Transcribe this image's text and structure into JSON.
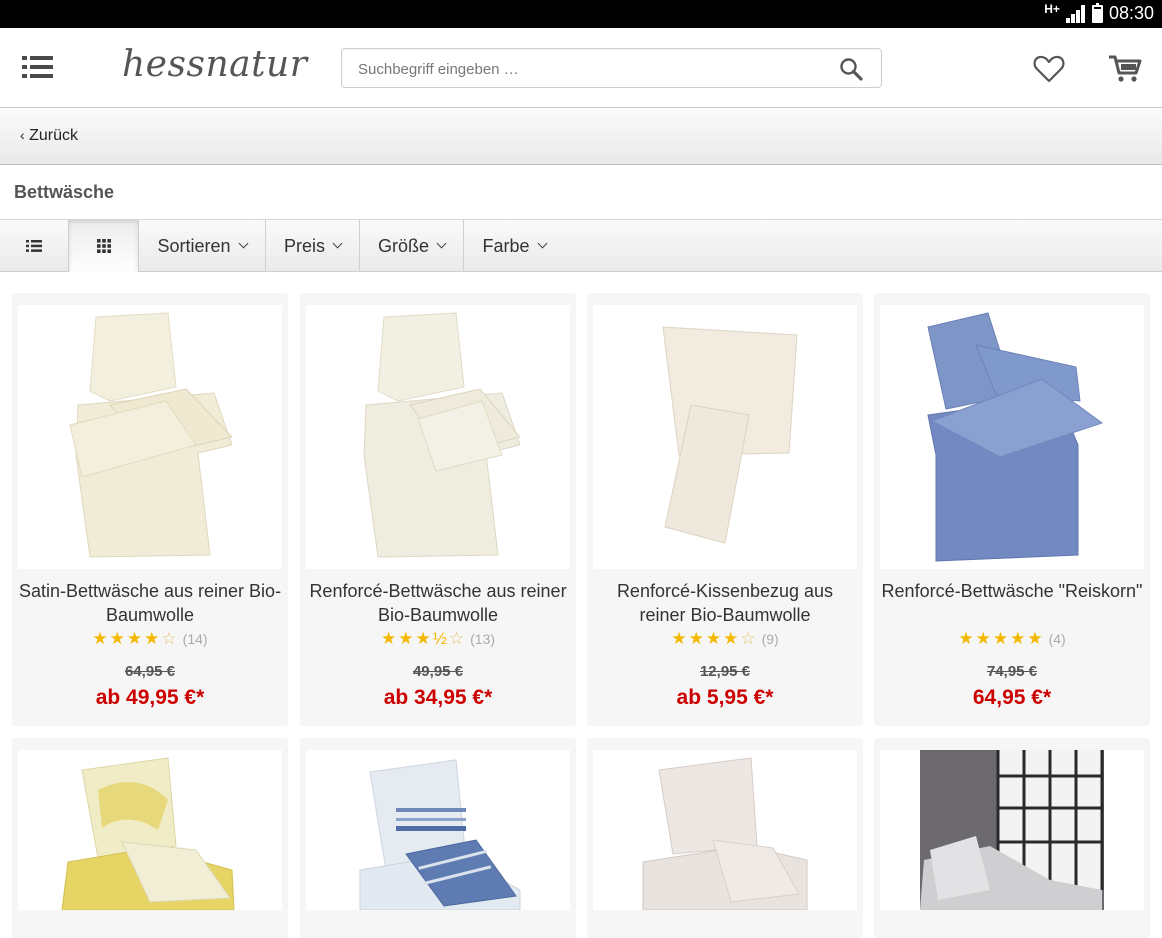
{
  "status_bar": {
    "network": "H+",
    "time": "08:30"
  },
  "header": {
    "logo": "hessnatur",
    "search_placeholder": "Suchbegriff eingeben …",
    "icons": [
      "menu-icon",
      "search-icon",
      "heart-icon",
      "cart-icon"
    ]
  },
  "back": {
    "label": "Zurück"
  },
  "page": {
    "title": "Bettwäsche"
  },
  "filters": {
    "list_view": "list-view-icon",
    "grid_view": "grid-view-icon",
    "sort": "Sortieren",
    "price": "Preis",
    "size": "Größe",
    "color": "Farbe"
  },
  "colors": {
    "price_red": "#cc0000",
    "star": "#f5b800"
  },
  "products": [
    {
      "title": "Satin-Bettwäsche aus reiner Bio-Baumwolle",
      "stars": "★★★★☆",
      "rating": 4,
      "count": "(14)",
      "old_price": "64,95 €",
      "price": "ab 49,95 €*"
    },
    {
      "title": "Renforcé-Bettwäsche aus reiner Bio-Baumwolle",
      "stars": "★★★½☆",
      "rating": 3.5,
      "count": "(13)",
      "old_price": "49,95 €",
      "price": "ab 34,95 €*"
    },
    {
      "title": "Renforcé-Kissenbezug aus reiner Bio-Baumwolle",
      "stars": "★★★★☆",
      "rating": 4,
      "count": "(9)",
      "old_price": "12,95 €",
      "price": "ab 5,95 €*"
    },
    {
      "title": "Renforcé-Bettwäsche \"Reiskorn\"",
      "stars": "★★★★★",
      "rating": 5,
      "count": "(4)",
      "old_price": "74,95 €",
      "price": "64,95 €*"
    }
  ]
}
